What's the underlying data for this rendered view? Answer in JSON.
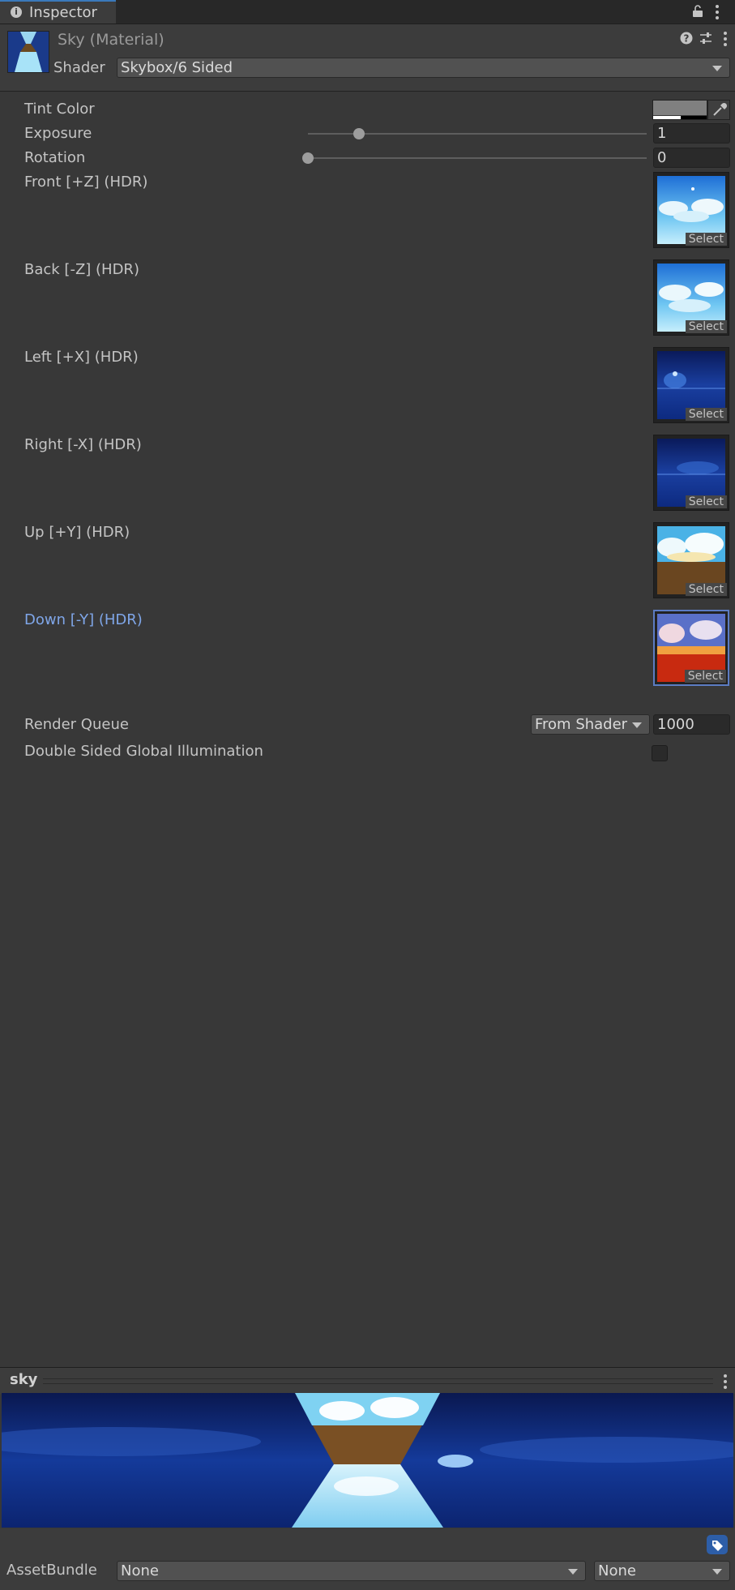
{
  "window": {
    "tab_title": "Inspector",
    "info_glyph": "i",
    "lock_icon": "lock-icon",
    "menu_icon": "kebab-icon"
  },
  "material": {
    "name": "Sky (Material)",
    "shader_label": "Shader",
    "shader_value": "Skybox/6 Sided",
    "header_icons": [
      "help-icon",
      "preset-icon",
      "kebab-icon"
    ]
  },
  "properties": {
    "tint_color": {
      "label": "Tint Color",
      "color": "#808080"
    },
    "exposure": {
      "label": "Exposure",
      "value": "1",
      "slider_fraction": 0.15
    },
    "rotation": {
      "label": "Rotation",
      "value": "0",
      "slider_fraction": 0.0
    },
    "textures": [
      {
        "label": "Front [+Z]   (HDR)",
        "select": "Select",
        "selected": false
      },
      {
        "label": "Back [-Z]   (HDR)",
        "select": "Select",
        "selected": false
      },
      {
        "label": "Left [+X]   (HDR)",
        "select": "Select",
        "selected": false
      },
      {
        "label": "Right [-X]   (HDR)",
        "select": "Select",
        "selected": false
      },
      {
        "label": "Up [+Y]   (HDR)",
        "select": "Select",
        "selected": false
      },
      {
        "label": "Down [-Y]   (HDR)",
        "select": "Select",
        "selected": true
      }
    ],
    "render_queue": {
      "label": "Render Queue",
      "mode": "From Shader",
      "value": "1000"
    },
    "double_sided_gi": {
      "label": "Double Sided Global Illumination",
      "checked": false
    }
  },
  "preview": {
    "title": "sky"
  },
  "footer": {
    "assetbundle_label": "AssetBundle",
    "bundle_name": "None",
    "bundle_variant": "None"
  },
  "colors": {
    "accent": "#3a79bb",
    "selected_label": "#7fa6e8",
    "background": "#383838"
  }
}
